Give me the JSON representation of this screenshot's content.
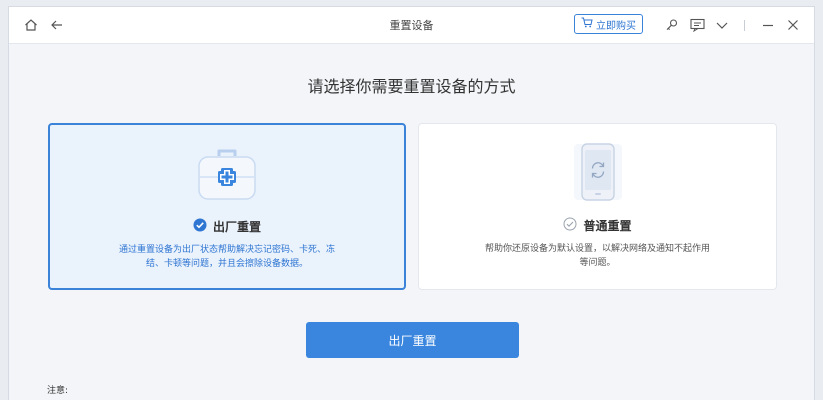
{
  "window": {
    "title": "重置设备",
    "buy_label": "立即购买"
  },
  "main": {
    "heading": "请选择你需要重置设备的方式",
    "options": [
      {
        "title": "出厂重置",
        "description": "通过重置设备为出厂状态帮助解决忘记密码、卡死、冻结、卡顿等问题，并且会擦除设备数据。",
        "selected": true
      },
      {
        "title": "普通重置",
        "description": "帮助你还原设备为默认设置，以解决网络及通知不起作用等问题。",
        "selected": false
      }
    ],
    "primary_button": "出厂重置",
    "note_label": "注意:"
  },
  "colors": {
    "accent": "#3a86df",
    "selected_bg": "#eaf2fc",
    "background": "#f3f5f8"
  },
  "icons": [
    "home-icon",
    "back-arrow-icon",
    "cart-icon",
    "key-icon",
    "feedback-icon",
    "chevron-down-icon",
    "minimize-icon",
    "close-icon",
    "first-aid-kit-icon",
    "check-circle-icon",
    "phone-reset-icon"
  ]
}
